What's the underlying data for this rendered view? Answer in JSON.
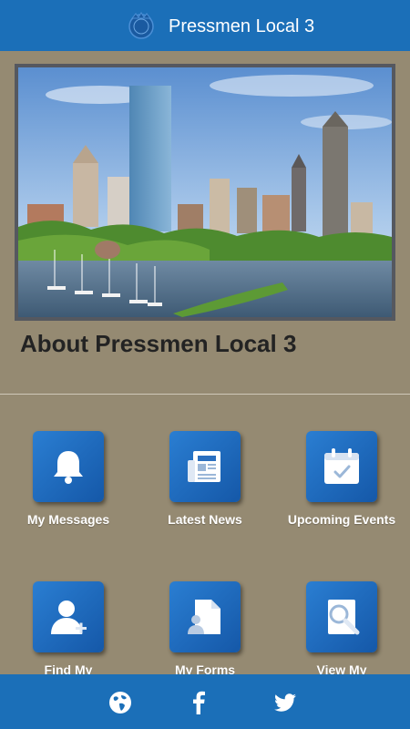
{
  "header": {
    "title": "Pressmen Local 3"
  },
  "about": {
    "title": "About Pressmen Local 3"
  },
  "tiles": [
    {
      "label": "My Messages",
      "icon": "bell-icon"
    },
    {
      "label": "Latest News",
      "icon": "newspaper-icon"
    },
    {
      "label": "Upcoming Events",
      "icon": "calendar-icon"
    },
    {
      "label": "Find My",
      "icon": "add-user-icon"
    },
    {
      "label": "My Forms",
      "icon": "document-user-icon"
    },
    {
      "label": "View My",
      "icon": "search-document-icon"
    }
  ],
  "footer": {
    "icons": [
      "globe-icon",
      "facebook-icon",
      "twitter-icon"
    ]
  },
  "colors": {
    "brand_blue": "#1b6fb8",
    "background": "#958a72",
    "tile_blue": "#1f6ec4"
  }
}
